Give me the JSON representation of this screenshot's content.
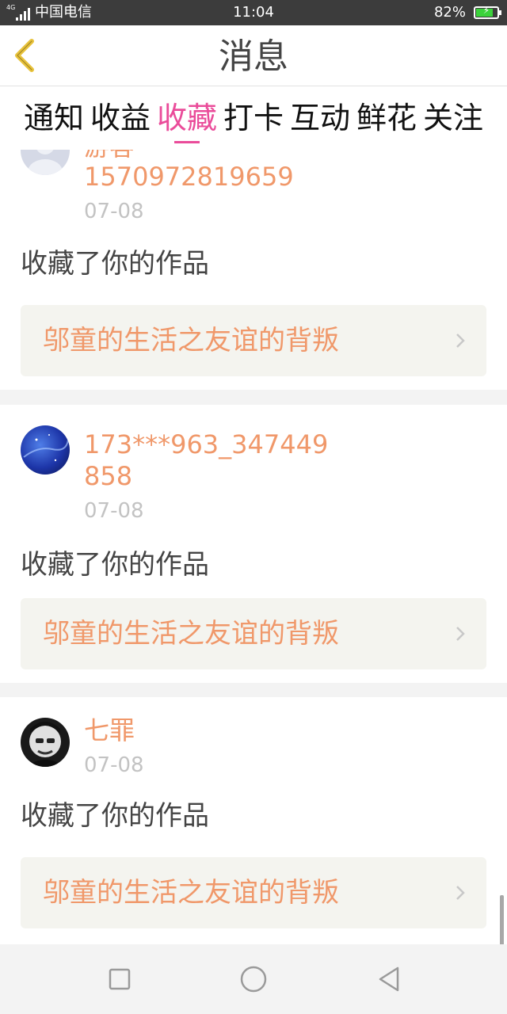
{
  "status_bar": {
    "network_tag": "4G",
    "carrier": "中国电信",
    "time": "11:04",
    "battery_percent": "82%",
    "battery_level": 0.82,
    "battery_charging": true,
    "battery_color": "#3bd23b"
  },
  "header": {
    "back_icon": "chevron-left-icon",
    "title": "消息"
  },
  "tabs": [
    {
      "label": "通知",
      "active": false
    },
    {
      "label": "收益",
      "active": false
    },
    {
      "label": "收藏",
      "active": true
    },
    {
      "label": "打卡",
      "active": false
    },
    {
      "label": "互动",
      "active": false
    },
    {
      "label": "鲜花",
      "active": false
    },
    {
      "label": "关注",
      "active": false
    }
  ],
  "colors": {
    "accent_pink": "#ea4c9a",
    "orange_text": "#f0986a",
    "back_icon_yellow": "#e8c23a"
  },
  "notifications": [
    {
      "name_partial": "游客",
      "name": "1570972819659",
      "date": "07-08",
      "action": "收藏了你的作品",
      "work_title": "邬童的生活之友谊的背叛"
    },
    {
      "name": "173***963_347449858",
      "date": "07-08",
      "action": "收藏了你的作品",
      "work_title": "邬童的生活之友谊的背叛"
    },
    {
      "name": "七罪",
      "date": "07-08",
      "action": "收藏了你的作品",
      "work_title": "邬童的生活之友谊的背叛"
    }
  ],
  "nav_bar": {
    "icons": [
      "square-icon",
      "circle-icon",
      "triangle-back-icon"
    ]
  }
}
